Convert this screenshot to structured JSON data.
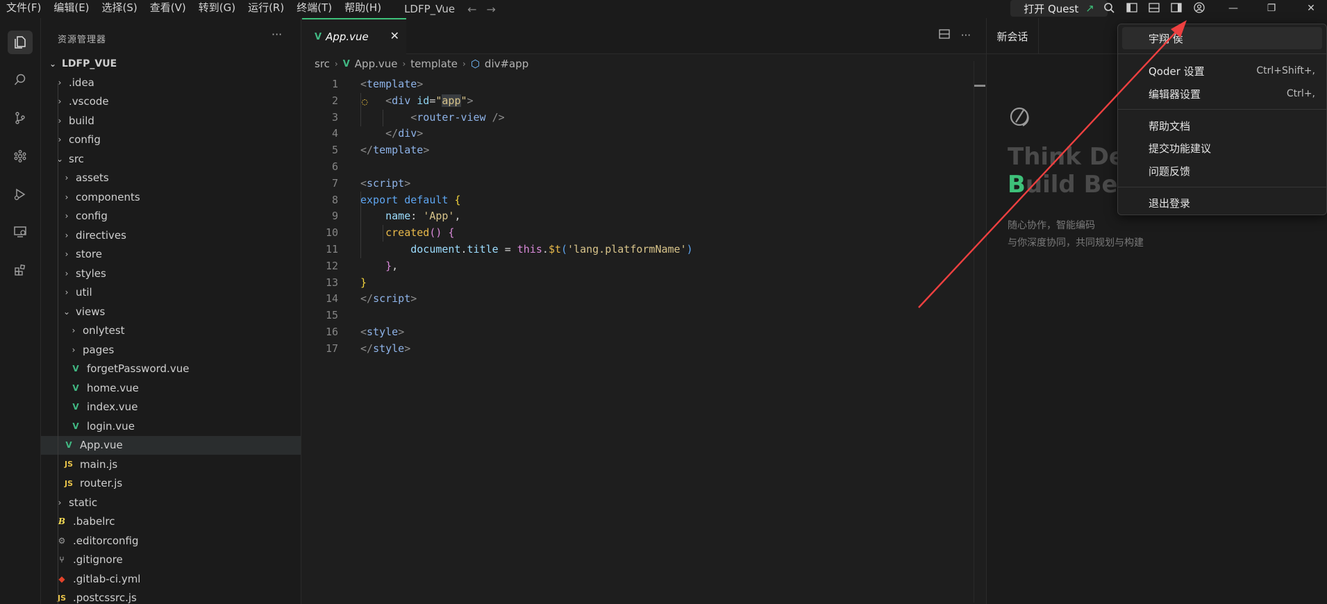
{
  "titlebar": {
    "menus": [
      "文件(F)",
      "编辑(E)",
      "选择(S)",
      "查看(V)",
      "转到(G)",
      "运行(R)",
      "终端(T)",
      "帮助(H)"
    ],
    "project": "LDFP_Vue",
    "quest_label": "打开 Quest",
    "icons": [
      "search-icon",
      "toggle-primary-sidebar-icon",
      "toggle-panel-icon",
      "toggle-secondary-sidebar-icon",
      "account-icon"
    ]
  },
  "activity": [
    "explorer-icon",
    "search-icon",
    "source-control-icon",
    "ai-agent-icon",
    "run-debug-icon",
    "remote-explorer-icon",
    "extensions-icon"
  ],
  "sidebar": {
    "title": "资源管理器",
    "root": "LDFP_VUE",
    "items": [
      {
        "label": ".idea",
        "kind": "folder",
        "depth": 1,
        "open": false
      },
      {
        "label": ".vscode",
        "kind": "folder",
        "depth": 1,
        "open": false
      },
      {
        "label": "build",
        "kind": "folder",
        "depth": 1,
        "open": false
      },
      {
        "label": "config",
        "kind": "folder",
        "depth": 1,
        "open": false
      },
      {
        "label": "src",
        "kind": "folder",
        "depth": 1,
        "open": true
      },
      {
        "label": "assets",
        "kind": "folder",
        "depth": 2,
        "open": false
      },
      {
        "label": "components",
        "kind": "folder",
        "depth": 2,
        "open": false
      },
      {
        "label": "config",
        "kind": "folder",
        "depth": 2,
        "open": false
      },
      {
        "label": "directives",
        "kind": "folder",
        "depth": 2,
        "open": false
      },
      {
        "label": "store",
        "kind": "folder",
        "depth": 2,
        "open": false
      },
      {
        "label": "styles",
        "kind": "folder",
        "depth": 2,
        "open": false
      },
      {
        "label": "util",
        "kind": "folder",
        "depth": 2,
        "open": false
      },
      {
        "label": "views",
        "kind": "folder",
        "depth": 2,
        "open": true
      },
      {
        "label": "onlytest",
        "kind": "folder",
        "depth": 3,
        "open": false
      },
      {
        "label": "pages",
        "kind": "folder",
        "depth": 3,
        "open": false
      },
      {
        "label": "forgetPassword.vue",
        "kind": "vue",
        "depth": 3
      },
      {
        "label": "home.vue",
        "kind": "vue",
        "depth": 3
      },
      {
        "label": "index.vue",
        "kind": "vue",
        "depth": 3
      },
      {
        "label": "login.vue",
        "kind": "vue",
        "depth": 3
      },
      {
        "label": "App.vue",
        "kind": "vue",
        "depth": 2,
        "selected": true
      },
      {
        "label": "main.js",
        "kind": "js",
        "depth": 2
      },
      {
        "label": "router.js",
        "kind": "js",
        "depth": 2
      },
      {
        "label": "static",
        "kind": "folder",
        "depth": 1,
        "open": false
      },
      {
        "label": ".babelrc",
        "kind": "babel",
        "depth": 1
      },
      {
        "label": ".editorconfig",
        "kind": "gear",
        "depth": 1
      },
      {
        "label": ".gitignore",
        "kind": "git",
        "depth": 1
      },
      {
        "label": ".gitlab-ci.yml",
        "kind": "gitlab",
        "depth": 1
      },
      {
        "label": ".postcssrc.js",
        "kind": "js",
        "depth": 1
      }
    ]
  },
  "editor": {
    "tab_label": "App.vue",
    "breadcrumb": [
      "src",
      "App.vue",
      "template",
      "div#app"
    ],
    "lines": [
      [
        [
          "brk",
          "<"
        ],
        [
          "tag",
          "template"
        ],
        [
          "brk",
          ">"
        ]
      ],
      [
        [
          "plain",
          "    "
        ],
        [
          "brk",
          "<"
        ],
        [
          "tag",
          "div"
        ],
        [
          "plain",
          " "
        ],
        [
          "attr",
          "id"
        ],
        [
          "plain",
          "="
        ],
        [
          "str",
          "\""
        ],
        [
          "strb",
          "app"
        ],
        [
          "str",
          "\""
        ],
        [
          "brk",
          ">"
        ]
      ],
      [
        [
          "plain",
          "        "
        ],
        [
          "brk",
          "<"
        ],
        [
          "tag",
          "router-view"
        ],
        [
          "plain",
          " "
        ],
        [
          "brk",
          "/>"
        ]
      ],
      [
        [
          "plain",
          "    "
        ],
        [
          "brk",
          "</"
        ],
        [
          "tag",
          "div"
        ],
        [
          "brk",
          ">"
        ]
      ],
      [
        [
          "brk",
          "</"
        ],
        [
          "tag",
          "template"
        ],
        [
          "brk",
          ">"
        ]
      ],
      [],
      [
        [
          "brk",
          "<"
        ],
        [
          "tag",
          "script"
        ],
        [
          "brk",
          ">"
        ]
      ],
      [
        [
          "kw",
          "export"
        ],
        [
          "plain",
          " "
        ],
        [
          "kw",
          "default"
        ],
        [
          "plain",
          " "
        ],
        [
          "yellow",
          "{"
        ]
      ],
      [
        [
          "plain",
          "    "
        ],
        [
          "ident",
          "name"
        ],
        [
          "plain",
          ": "
        ],
        [
          "str",
          "'App'"
        ],
        [
          "plain",
          ","
        ]
      ],
      [
        [
          "plain",
          "    "
        ],
        [
          "fn",
          "created"
        ],
        [
          "pink",
          "()"
        ],
        [
          "plain",
          " "
        ],
        [
          "pink",
          "{"
        ]
      ],
      [
        [
          "plain",
          "        "
        ],
        [
          "ident",
          "document"
        ],
        [
          "plain",
          "."
        ],
        [
          "ident",
          "title"
        ],
        [
          "plain",
          " = "
        ],
        [
          "pink",
          "this"
        ],
        [
          "plain",
          "."
        ],
        [
          "fn",
          "$t"
        ],
        [
          "kw",
          "("
        ],
        [
          "str",
          "'lang.platformName'"
        ],
        [
          "kw",
          ")"
        ]
      ],
      [
        [
          "plain",
          "    "
        ],
        [
          "pink",
          "}"
        ],
        [
          "plain",
          ","
        ]
      ],
      [
        [
          "yellow",
          "}"
        ]
      ],
      [
        [
          "brk",
          "</"
        ],
        [
          "tag",
          "script"
        ],
        [
          "brk",
          ">"
        ]
      ],
      [],
      [
        [
          "brk",
          "<"
        ],
        [
          "tag",
          "style"
        ],
        [
          "brk",
          ">"
        ]
      ],
      [
        [
          "brk",
          "</"
        ],
        [
          "tag",
          "style"
        ],
        [
          "brk",
          ">"
        ]
      ]
    ]
  },
  "chat": {
    "tab_label": "新会话",
    "hero_line1": "Think Deep",
    "hero_line2_first": "B",
    "hero_line2_rest": "uild Bette",
    "sub1": "随心协作，智能编码",
    "sub2": "与你深度协同，共同规划与构建"
  },
  "dropdown": {
    "items": [
      {
        "label": "宇翔 侯",
        "shortcut": ""
      },
      {
        "label": "Qoder 设置",
        "shortcut": "Ctrl+Shift+,"
      },
      {
        "label": "编辑器设置",
        "shortcut": "Ctrl+,"
      },
      {
        "label": "帮助文档",
        "shortcut": ""
      },
      {
        "label": "提交功能建议",
        "shortcut": ""
      },
      {
        "label": "问题反馈",
        "shortcut": ""
      },
      {
        "label": "退出登录",
        "shortcut": ""
      }
    ]
  },
  "colors": {
    "accent": "#3ec17a",
    "annotation": "#ee4040"
  }
}
